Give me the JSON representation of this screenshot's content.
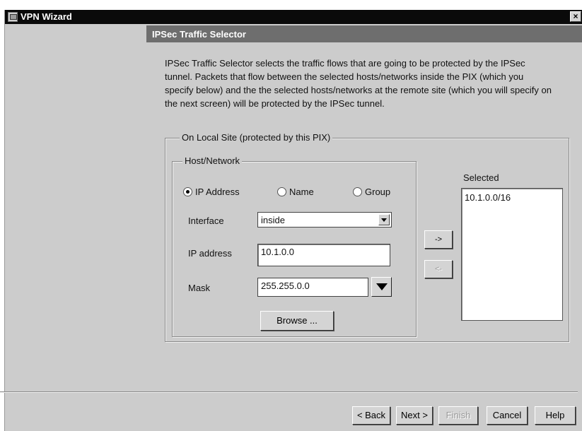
{
  "window": {
    "title": "VPN Wizard",
    "close_glyph": "×"
  },
  "header": {
    "title": "IPSec Traffic Selector"
  },
  "description": "IPSec Traffic Selector selects the traffic flows that are going to be protected by the IPSec tunnel. Packets that flow between the selected hosts/networks inside the PIX (which you specify below) and the the selected hosts/networks at the remote site (which you will specify on the next screen) will be protected by the IPSec tunnel.",
  "local_site": {
    "legend": "On Local Site (protected by this PIX)",
    "host_network": {
      "legend": "Host/Network",
      "radios": [
        {
          "label": "IP Address",
          "selected": true
        },
        {
          "label": "Name",
          "selected": false
        },
        {
          "label": "Group",
          "selected": false
        }
      ],
      "interface": {
        "label": "Interface",
        "value": "inside"
      },
      "ip_address": {
        "label": "IP address",
        "value": "10.1.0.0"
      },
      "mask": {
        "label": "Mask",
        "value": "255.255.0.0"
      },
      "browse_label": "Browse ..."
    },
    "add_label": "->",
    "remove_label": "<-",
    "selected": {
      "label": "Selected",
      "items": [
        "10.1.0.0/16"
      ]
    }
  },
  "footer": {
    "back": "< Back",
    "next": "Next >",
    "finish": "Finish",
    "cancel": "Cancel",
    "help": "Help"
  },
  "icons": {
    "app": "vpn-wizard-app-icon",
    "close": "close-icon",
    "dropdown": "chevron-down-icon"
  }
}
